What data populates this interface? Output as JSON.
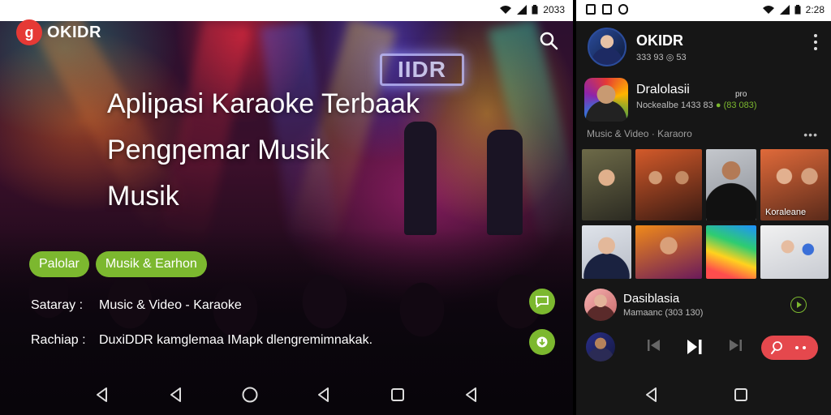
{
  "left_screen": {
    "status_bar": {
      "time": "2033"
    },
    "brand": {
      "logo_letter": "g",
      "name": "OKIDR"
    },
    "stage_sign": "IIDR",
    "headline": {
      "line1": "Aplipasi Karaoke Terbaak",
      "line2": "Pengŋemar Musik",
      "line3": "Musik"
    },
    "chips": [
      "Palolar",
      "Musik & Earhon"
    ],
    "info": [
      {
        "key": "Sataray :",
        "value": "Music & Video - Karaoke"
      },
      {
        "key": "Rachiap :",
        "value": "DuxiDDR kamglemaa IMapk dlengremimnakak."
      }
    ],
    "icons": [
      "search-icon",
      "chat-bubble-icon",
      "download-icon"
    ],
    "colors": {
      "accent_green": "#7cb82f",
      "logo_red": "#e53935"
    }
  },
  "right_screen": {
    "status_bar": {
      "time": "2:28"
    },
    "profile": {
      "name": "OKIDR",
      "sub": "333 93   ◎ 53"
    },
    "featured": {
      "title": "Dralolasii",
      "badge": "pro",
      "sub": "Nockealbe 1433 83",
      "sub_green": "(83 083)"
    },
    "section": {
      "title": "Music & Video · Karaoro",
      "more": "•••"
    },
    "tiles": [
      {
        "label": ""
      },
      {
        "label": ""
      },
      {
        "label": ""
      },
      {
        "label": "Koraleane"
      },
      {
        "label": ""
      },
      {
        "label": ""
      },
      {
        "label": ""
      },
      {
        "label": ""
      }
    ],
    "now_playing": {
      "title": "Dasiblasia",
      "sub": "Mamaanc (303 130)"
    },
    "colors": {
      "accent_red": "#e5484d",
      "accent_green": "#7cb82f"
    }
  }
}
